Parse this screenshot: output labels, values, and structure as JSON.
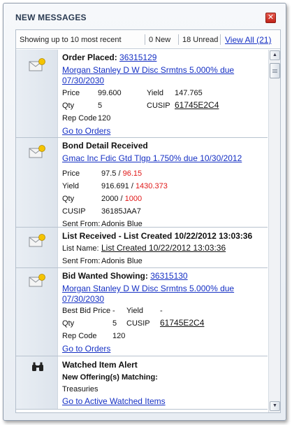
{
  "window": {
    "title": "NEW MESSAGES",
    "close_glyph": "✕"
  },
  "status": {
    "showing": "Showing up to 10 most recent",
    "new": "0 New",
    "unread": "18 Unread",
    "view_all": "View All (21)"
  },
  "messages": [
    {
      "icon": "envelope-icon",
      "title_prefix": "Order Placed: ",
      "title_link": "36315129",
      "security_line1": "Morgan Stanley D W Disc Srmtns 5.000% due",
      "security_line2": "07/30/2030",
      "price_label": "Price",
      "price": "99.600",
      "yield_label": "Yield",
      "yield": "147.765",
      "qty_label": "Qty",
      "qty": "5",
      "cusip_label": "CUSIP",
      "cusip": "61745E2C4",
      "rep_label": "Rep Code",
      "rep": "120",
      "action": "Go to Orders"
    },
    {
      "icon": "envelope-icon",
      "title": "Bond Detail Received",
      "security": "Gmac Inc Fdic Gtd Tlgp 1.750% due 10/30/2012",
      "price_label": "Price",
      "price_old": "97.5 / ",
      "price_new": "96.15",
      "yield_label": "Yield",
      "yield_old": "916.691 / ",
      "yield_new": "1430.373",
      "qty_label": "Qty",
      "qty_old": "2000 / ",
      "qty_new": "1000",
      "cusip_label": "CUSIP",
      "cusip": "36185JAA7",
      "sent_label": "Sent From:",
      "sent": "Adonis Blue"
    },
    {
      "icon": "envelope-icon",
      "title": "List Received - List Created 10/22/2012 13:03:36",
      "list_label": "List Name:",
      "list_link": "List Created 10/22/2012 13:03:36",
      "sent_label": "Sent From:",
      "sent": "Adonis Blue"
    },
    {
      "icon": "envelope-icon",
      "title_prefix": "Bid Wanted Showing: ",
      "title_link": "36315130",
      "security_line1": "Morgan Stanley D W Disc Srmtns 5.000% due",
      "security_line2": "07/30/2030",
      "bid_label": "Best Bid Price",
      "bid": "-",
      "yield_label": "Yield",
      "yield": "-",
      "qty_label": "Qty",
      "qty": "5",
      "cusip_label": "CUSIP",
      "cusip": "61745E2C4",
      "rep_label": "Rep Code",
      "rep": "120",
      "action": "Go to Orders"
    },
    {
      "icon": "binoculars-icon",
      "title": "Watched Item Alert",
      "subtitle": "New Offering(s) Matching:",
      "item": "Treasuries",
      "action": "Go to Active Watched Items"
    }
  ],
  "colors": {
    "link": "#1530c4",
    "changed_value": "#e01818",
    "close": "#c0241a"
  }
}
